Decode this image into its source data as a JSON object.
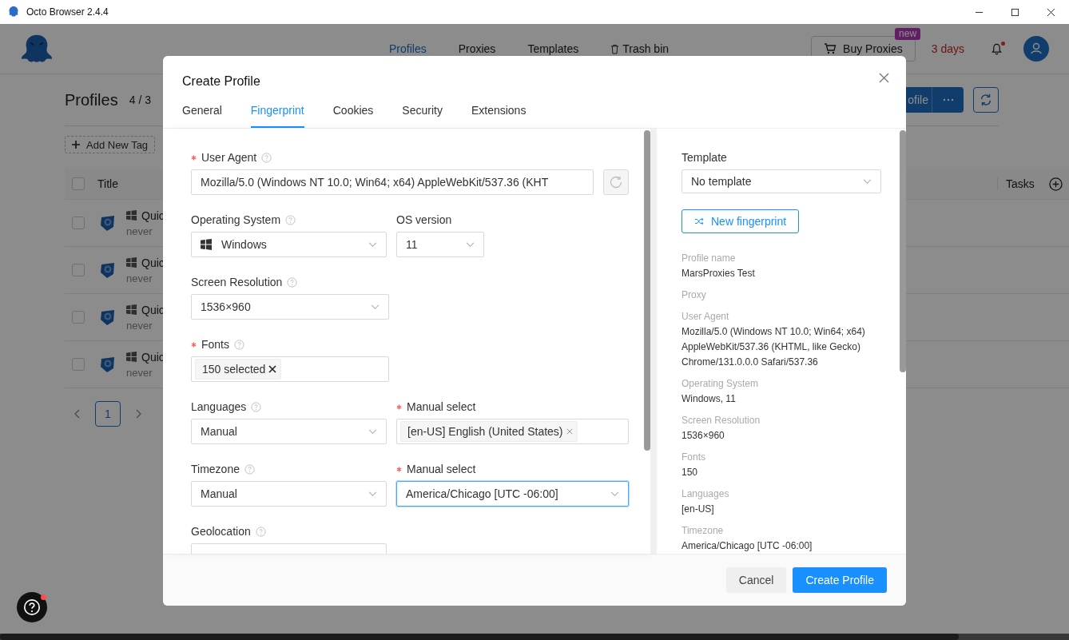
{
  "window": {
    "title": "Octo Browser 2.4.4"
  },
  "header": {
    "nav": [
      {
        "label": "Profiles",
        "selected": true,
        "kind": "link"
      },
      {
        "label": "Proxies",
        "selected": false,
        "kind": "link"
      },
      {
        "label": "Templates",
        "selected": false,
        "kind": "link"
      },
      {
        "label": "Trash bin",
        "selected": false,
        "kind": "trash"
      }
    ],
    "buy_button": {
      "label": "Buy Proxies",
      "badge": "new"
    },
    "trial": "3 days",
    "notifications_unread": true
  },
  "page": {
    "title": "Profiles",
    "count": "4 / 3",
    "action_button": "ofile",
    "add_tag": "Add New Tag",
    "columns": [
      "Title",
      "Tasks"
    ],
    "all_checked": false,
    "rows": [
      {
        "name": "Quic",
        "last_run": "never",
        "checked": false
      },
      {
        "name": "Quic",
        "last_run": "never",
        "checked": false
      },
      {
        "name": "Quic",
        "last_run": "never",
        "checked": false
      },
      {
        "name": "Quic",
        "last_run": "never",
        "checked": false
      }
    ],
    "pages": [
      {
        "label": "1",
        "selected": true
      }
    ]
  },
  "help": {
    "unread": true
  },
  "dialog": {
    "title": "Create Profile",
    "tabs": [
      {
        "label": "General",
        "selected": false
      },
      {
        "label": "Fingerprint",
        "selected": true
      },
      {
        "label": "Cookies",
        "selected": false
      },
      {
        "label": "Security",
        "selected": false
      },
      {
        "label": "Extensions",
        "selected": false
      }
    ],
    "form": [
      {
        "fields": [
          {
            "label": "User Agent",
            "required": true,
            "help": true,
            "kind": "input",
            "value": "Mozilla/5.0 (Windows NT 10.0; Win64; x64) AppleWebKit/537.36 (KHT",
            "focused": false
          }
        ]
      },
      {
        "fields": [
          {
            "label": "Operating System",
            "required": false,
            "help": true,
            "kind": "os-select",
            "value": "Windows",
            "focused": false
          },
          {
            "label": "OS version",
            "required": false,
            "help": false,
            "kind": "select",
            "value": "11",
            "focused": false
          }
        ]
      },
      {
        "fields": [
          {
            "label": "Screen Resolution",
            "required": false,
            "help": true,
            "kind": "select",
            "value": "1536×960",
            "focused": false
          }
        ]
      },
      {
        "fields": [
          {
            "label": "Fonts",
            "required": true,
            "help": true,
            "kind": "tags",
            "tags": [
              "150 selected"
            ],
            "focused": false
          }
        ]
      },
      {
        "fields": [
          {
            "label": "Languages",
            "required": false,
            "help": true,
            "kind": "select",
            "value": "Manual",
            "focused": false
          },
          {
            "label": "Manual select",
            "required": true,
            "help": false,
            "kind": "tags",
            "tags": [
              "[en-US] English (United States)"
            ],
            "focused": false
          }
        ]
      },
      {
        "fields": [
          {
            "label": "Timezone",
            "required": false,
            "help": true,
            "kind": "select",
            "value": "Manual",
            "focused": false
          },
          {
            "label": "Manual select",
            "required": true,
            "help": false,
            "kind": "select",
            "value": "America/Chicago [UTC -06:00]",
            "focused": true
          }
        ]
      },
      {
        "fields": [
          {
            "label": "Geolocation",
            "required": false,
            "help": true,
            "kind": "select",
            "focused": false
          }
        ]
      }
    ],
    "summary": {
      "template_label": "Template",
      "template": "No template",
      "new_fingerprint": "New fingerprint",
      "items": [
        {
          "label": "Profile name",
          "values": [
            "MarsProxies Test"
          ]
        },
        {
          "label": "Proxy"
        },
        {
          "label": "User Agent",
          "values": [
            "Mozilla/5.0 (Windows NT 10.0; Win64; x64)",
            "AppleWebKit/537.36 (KHTML, like Gecko)",
            "Chrome/131.0.0.0 Safari/537.36"
          ]
        },
        {
          "label": "Operating System",
          "values": [
            "Windows, 11"
          ]
        },
        {
          "label": "Screen Resolution",
          "values": [
            "1536×960"
          ]
        },
        {
          "label": "Fonts",
          "values": [
            "150"
          ]
        },
        {
          "label": "Languages",
          "values": [
            "[en-US]"
          ]
        },
        {
          "label": "Timezone",
          "values": [
            "America/Chicago [UTC -06:00]"
          ]
        }
      ]
    },
    "buttons": [
      {
        "label": "Cancel",
        "kind": "default"
      },
      {
        "label": "Create Profile",
        "kind": "primary"
      }
    ]
  }
}
